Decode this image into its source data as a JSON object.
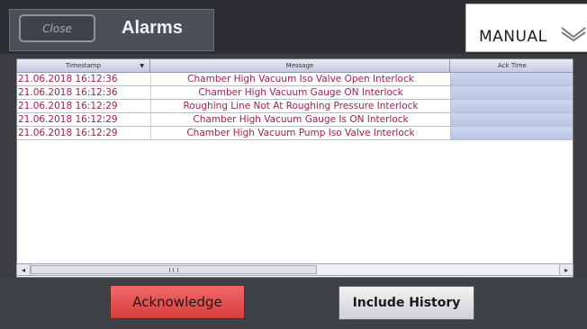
{
  "header": {
    "close_label": "Close",
    "title": "Alarms",
    "mode": "MANUAL",
    "mode_icon": "chevron-down-icon"
  },
  "table": {
    "columns": [
      "Timestamp",
      "Message",
      "Ack Time"
    ],
    "sort_icon": "sort-down-icon",
    "rows": [
      {
        "timestamp": "21.06.2018 16:12:36",
        "message": "Chamber High Vacuum Iso Valve Open Interlock",
        "ack_time": ""
      },
      {
        "timestamp": "21.06.2018 16:12:36",
        "message": "Chamber High Vacuum Gauge ON Interlock",
        "ack_time": ""
      },
      {
        "timestamp": "21.06.2018 16:12:29",
        "message": "Roughing Line Not At Roughing Pressure Interlock",
        "ack_time": ""
      },
      {
        "timestamp": "21.06.2018 16:12:29",
        "message": "Chamber High Vacuum Gauge Is ON Interlock",
        "ack_time": ""
      },
      {
        "timestamp": "21.06.2018 16:12:29",
        "message": "Chamber High Vacuum Pump Iso Valve Interlock",
        "ack_time": ""
      }
    ],
    "text_color": "#9e2050",
    "ack_cell_color": "#c3cde8"
  },
  "footer": {
    "acknowledge_label": "Acknowledge",
    "include_history_label": "Include History",
    "acknowledge_color": "#e85050"
  }
}
